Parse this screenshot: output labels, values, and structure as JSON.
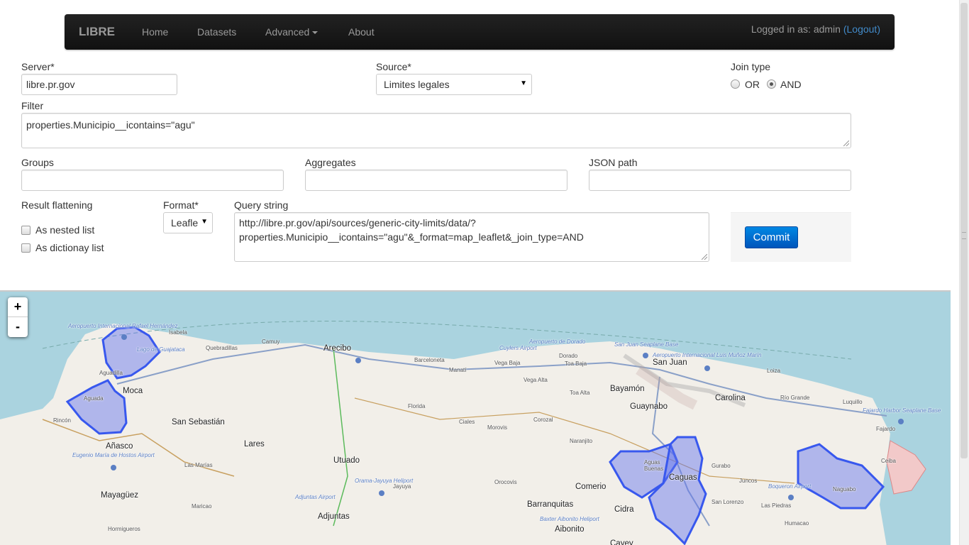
{
  "navbar": {
    "brand": "LIBRE",
    "links": [
      "Home",
      "Datasets",
      "Advanced",
      "About"
    ],
    "login_text": "Logged in as: admin",
    "logout_label": "(Logout)"
  },
  "form": {
    "server": {
      "label": "Server*",
      "value": "libre.pr.gov"
    },
    "source": {
      "label": "Source*",
      "value": "Limites legales"
    },
    "join_type": {
      "label": "Join type",
      "options": [
        "OR",
        "AND"
      ],
      "selected": "AND"
    },
    "filter": {
      "label": "Filter",
      "value": "properties.Municipio__icontains=\"agu\""
    },
    "groups": {
      "label": "Groups",
      "value": ""
    },
    "aggregates": {
      "label": "Aggregates",
      "value": ""
    },
    "json_path": {
      "label": "JSON path",
      "value": ""
    },
    "result_flattening": {
      "label": "Result flattening",
      "options": [
        "As nested list",
        "As dictionay list"
      ]
    },
    "format": {
      "label": "Format*",
      "value": "Leafle"
    },
    "query_string": {
      "label": "Query string",
      "line1": "http://libre.pr.gov/api/sources/generic-city-limits/data/?",
      "line2": "properties.Municipio__icontains=\"agu\"&_format=map_leaflet&_join_type=AND"
    },
    "commit_label": "Commit"
  },
  "map": {
    "zoom_in": "+",
    "zoom_out": "-",
    "highlight_color": "#4d6bf0",
    "water_color": "#aad3df",
    "land_color": "#f2efe9",
    "places": [
      {
        "name": "Isabela",
        "size": "small"
      },
      {
        "name": "Quebradillas",
        "size": "small"
      },
      {
        "name": "Camuy",
        "size": "small"
      },
      {
        "name": "Arecibo",
        "size": "big"
      },
      {
        "name": "Barceloneta",
        "size": "small"
      },
      {
        "name": "Manatí",
        "size": "small"
      },
      {
        "name": "Vega Baja",
        "size": "small"
      },
      {
        "name": "Dorado",
        "size": "small"
      },
      {
        "name": "Toa Baja",
        "size": "small"
      },
      {
        "name": "San Juan",
        "size": "big"
      },
      {
        "name": "Loiza",
        "size": "small"
      },
      {
        "name": "Aguadilla",
        "size": "small"
      },
      {
        "name": "Moca",
        "size": "big"
      },
      {
        "name": "Aguada",
        "size": "small"
      },
      {
        "name": "Rincón",
        "size": "small"
      },
      {
        "name": "San Sebastián",
        "size": "big"
      },
      {
        "name": "Vega Alta",
        "size": "small"
      },
      {
        "name": "Toa Alta",
        "size": "small"
      },
      {
        "name": "Bayamón",
        "size": "big"
      },
      {
        "name": "Carolina",
        "size": "big"
      },
      {
        "name": "Río Grande",
        "size": "small"
      },
      {
        "name": "Luquillo",
        "size": "small"
      },
      {
        "name": "Guaynabo",
        "size": "big"
      },
      {
        "name": "Florida",
        "size": "small"
      },
      {
        "name": "Ciales",
        "size": "small"
      },
      {
        "name": "Corozal",
        "size": "small"
      },
      {
        "name": "Morovis",
        "size": "small"
      },
      {
        "name": "Añasco",
        "size": "big"
      },
      {
        "name": "Lares",
        "size": "big"
      },
      {
        "name": "Naranjito",
        "size": "small"
      },
      {
        "name": "Fajardo",
        "size": "small"
      },
      {
        "name": "Utuado",
        "size": "big"
      },
      {
        "name": "Las Marías",
        "size": "small"
      },
      {
        "name": "Aguas Buenas",
        "size": "small"
      },
      {
        "name": "Caguas",
        "size": "big"
      },
      {
        "name": "Gurabo",
        "size": "small"
      },
      {
        "name": "Juncos",
        "size": "small"
      },
      {
        "name": "Ceiba",
        "size": "small"
      },
      {
        "name": "Jayuya",
        "size": "small"
      },
      {
        "name": "Orocovis",
        "size": "small"
      },
      {
        "name": "Comerio",
        "size": "big"
      },
      {
        "name": "Naguabo",
        "size": "small"
      },
      {
        "name": "Mayagüez",
        "size": "big"
      },
      {
        "name": "Maricao",
        "size": "small"
      },
      {
        "name": "Barranquitas",
        "size": "big"
      },
      {
        "name": "Cidra",
        "size": "big"
      },
      {
        "name": "San Lorenzo",
        "size": "small"
      },
      {
        "name": "Las Piedras",
        "size": "small"
      },
      {
        "name": "Adjuntas",
        "size": "big"
      },
      {
        "name": "Humacao",
        "size": "small"
      },
      {
        "name": "Hormigueros",
        "size": "small"
      },
      {
        "name": "Aibonito",
        "size": "big"
      },
      {
        "name": "Cayey",
        "size": "big"
      }
    ],
    "airports": [
      "Aeropuerto Internacional Rafael Hernández",
      "Lago de Guajataca",
      "Aeropuerto de Dorado",
      "Cuylers Airport",
      "San Juan Seaplane Base",
      "Aeropuerto Internacional Luis Muñoz Marín",
      "Fajardo Harbor Seaplane Base",
      "Eugenio María de Hostos Airport",
      "Orama-Jayuya Heliport",
      "Adjuntas Airport",
      "Boqueron Airport",
      "Baxter Aibonito Heliport"
    ]
  }
}
